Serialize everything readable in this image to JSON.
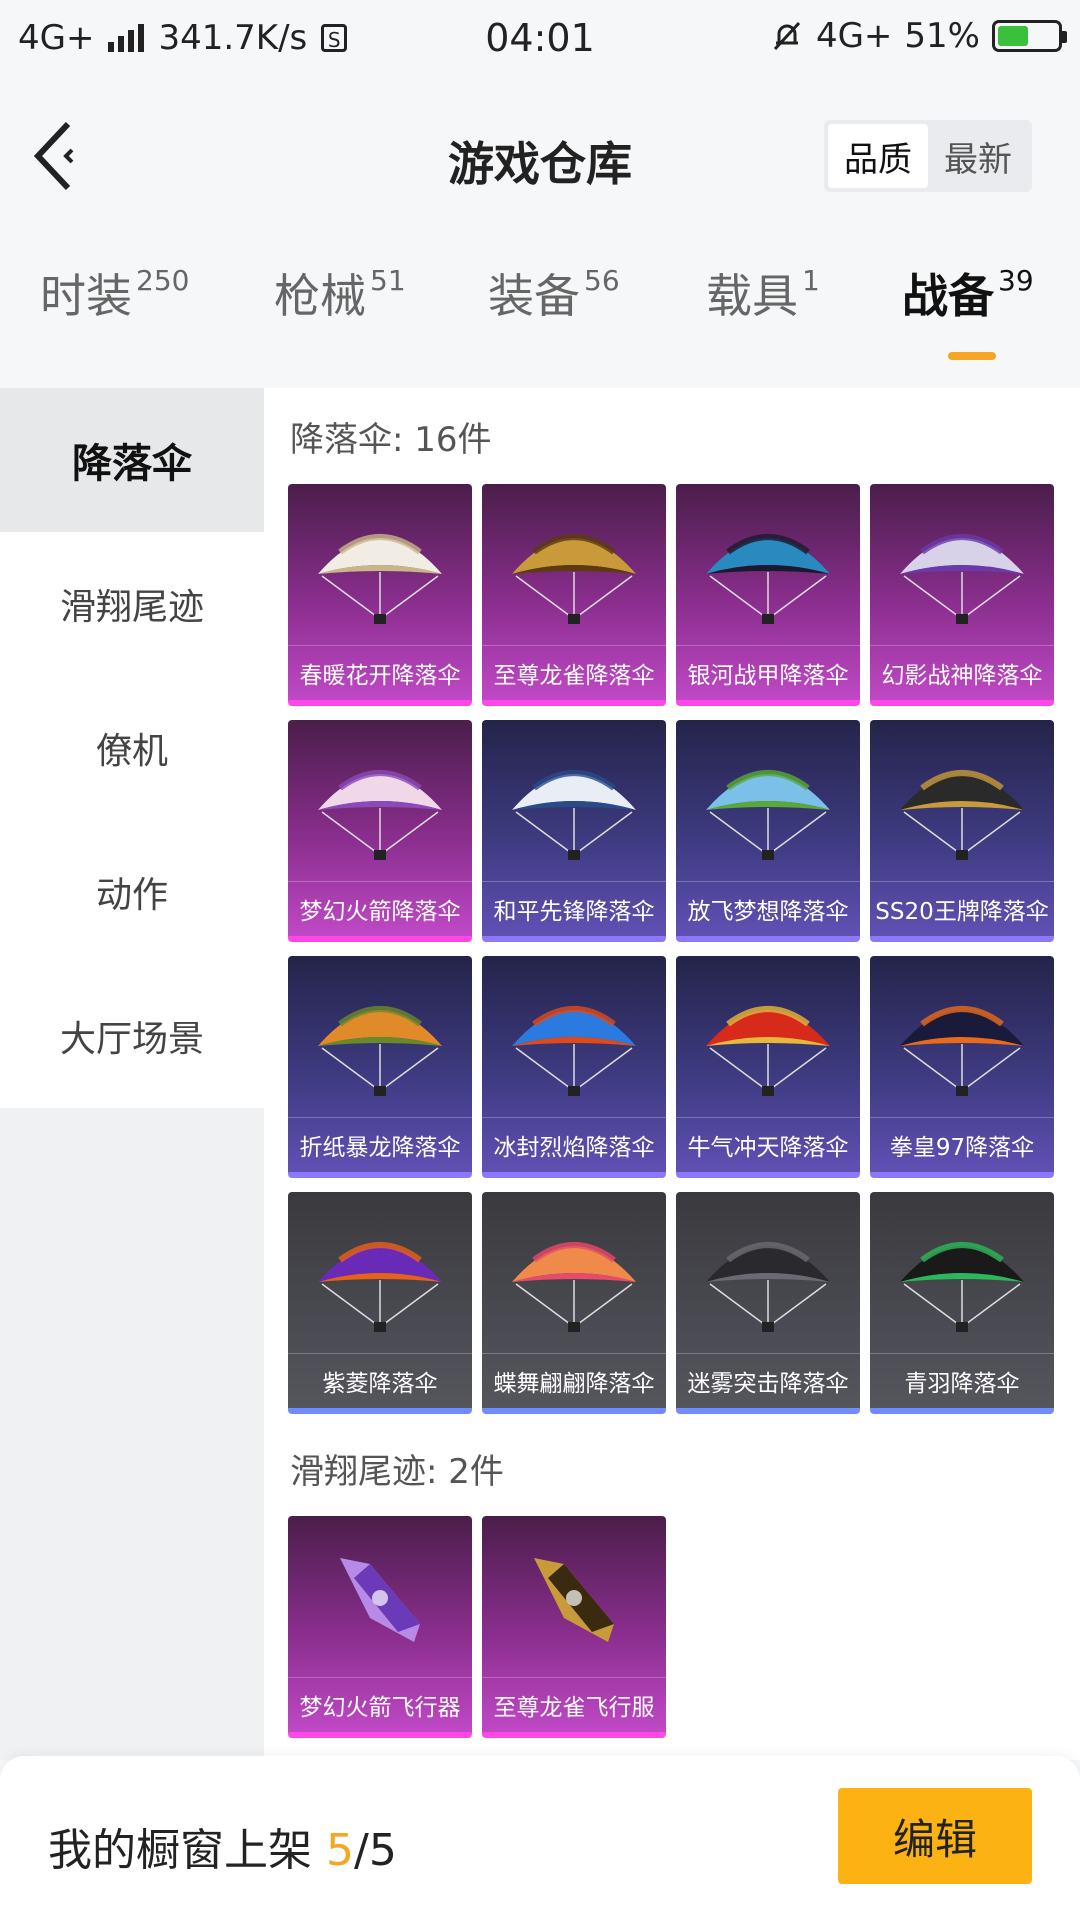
{
  "status_bar": {
    "network": "4G+",
    "speed": "341.7K/s",
    "time": "04:01",
    "network_right": "4G+",
    "battery": "51%"
  },
  "header": {
    "title": "游戏仓库",
    "sort_options": [
      "品质",
      "最新"
    ],
    "active_sort": "品质"
  },
  "tabs": [
    {
      "label": "时装",
      "count": "250"
    },
    {
      "label": "枪械",
      "count": "51"
    },
    {
      "label": "装备",
      "count": "56"
    },
    {
      "label": "载具",
      "count": "1"
    },
    {
      "label": "战备",
      "count": "39"
    }
  ],
  "active_tab": "战备",
  "sidebar": {
    "items": [
      "降落伞",
      "滑翔尾迹",
      "僚机",
      "动作",
      "大厅场景"
    ],
    "active": "降落伞"
  },
  "sections": [
    {
      "title": "降落伞: 16件",
      "items": [
        {
          "name": "春暖花开降落伞",
          "tier": "purple",
          "colors": [
            "#f1ede4",
            "#c9b58a"
          ]
        },
        {
          "name": "至尊龙雀降落伞",
          "tier": "purple",
          "colors": [
            "#c89a3a",
            "#5e3a10"
          ]
        },
        {
          "name": "银河战甲降落伞",
          "tier": "purple",
          "colors": [
            "#2a8ac0",
            "#1a1a2e"
          ]
        },
        {
          "name": "幻影战神降落伞",
          "tier": "purple",
          "colors": [
            "#d8d2e8",
            "#6a3aa8"
          ]
        },
        {
          "name": "梦幻火箭降落伞",
          "tier": "purple",
          "colors": [
            "#f0d8e8",
            "#8a4ab8"
          ]
        },
        {
          "name": "和平先锋降落伞",
          "tier": "blue",
          "colors": [
            "#e8eef4",
            "#2a4a8a"
          ]
        },
        {
          "name": "放飞梦想降落伞",
          "tier": "blue",
          "colors": [
            "#7ac0e8",
            "#5aa838"
          ]
        },
        {
          "name": "SS20王牌降落伞",
          "tier": "blue",
          "colors": [
            "#2a2a2a",
            "#c89a3a"
          ]
        },
        {
          "name": "折纸暴龙降落伞",
          "tier": "blue",
          "colors": [
            "#e08a2a",
            "#6a8a2a"
          ]
        },
        {
          "name": "冰封烈焰降落伞",
          "tier": "blue",
          "colors": [
            "#2a7ae0",
            "#e04a1a"
          ]
        },
        {
          "name": "牛气冲天降落伞",
          "tier": "blue",
          "colors": [
            "#d82a1a",
            "#e8b83a"
          ]
        },
        {
          "name": "拳皇97降落伞",
          "tier": "blue",
          "colors": [
            "#1a1a3a",
            "#e86a1a"
          ]
        },
        {
          "name": "紫菱降落伞",
          "tier": "gray",
          "colors": [
            "#6a2ab8",
            "#e8601a"
          ]
        },
        {
          "name": "蝶舞翩翩降落伞",
          "tier": "gray",
          "colors": [
            "#f08a4a",
            "#e84a6a"
          ]
        },
        {
          "name": "迷雾突击降落伞",
          "tier": "gray",
          "colors": [
            "#2a2a2e",
            "#6a6a72"
          ]
        },
        {
          "name": "青羽降落伞",
          "tier": "gray",
          "colors": [
            "#1a1a1a",
            "#2ab85a"
          ]
        }
      ]
    },
    {
      "title": "滑翔尾迹: 2件",
      "items": [
        {
          "name": "梦幻火箭飞行器",
          "tier": "purple",
          "colors": [
            "#b88ae8",
            "#6a3ab8"
          ]
        },
        {
          "name": "至尊龙雀飞行服",
          "tier": "purple",
          "colors": [
            "#c89a3a",
            "#3a2a10"
          ]
        }
      ]
    }
  ],
  "bottom_bar": {
    "showcase_label": "我的橱窗上架",
    "showcase_count": "5",
    "showcase_total": "/5",
    "edit_label": "编辑"
  },
  "accent_color": "#f5a623"
}
